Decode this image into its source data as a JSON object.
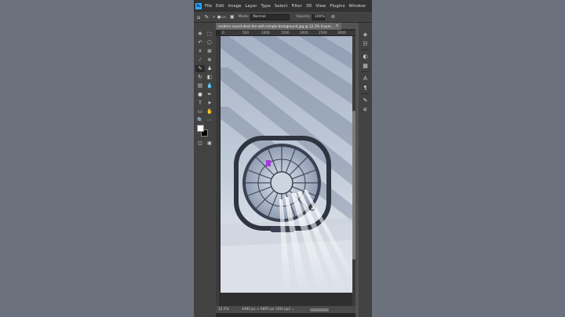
{
  "app": {
    "logo_text": "Ps"
  },
  "menu": [
    "File",
    "Edit",
    "Image",
    "Layer",
    "Type",
    "Select",
    "Filter",
    "3D",
    "View",
    "Plugins",
    "Window"
  ],
  "options_bar": {
    "icons": [
      "home-icon",
      "brush-icon",
      "brush-preset-icon"
    ],
    "brush_size": "125",
    "mode_label": "Mode:",
    "mode_value": "Normal",
    "opacity_label": "Opacity:",
    "opacity_value": "100%"
  },
  "document": {
    "tab_title": "modern-round-desk-fan-with-simple-background.jpg @ 12.2% (Layer...",
    "close_glyph": "×",
    "ruler_numbers": [
      "0",
      "500",
      "1000",
      "1500",
      "2000",
      "2500",
      "3000"
    ]
  },
  "tools": [
    {
      "name": "move-tool-icon",
      "glyph": "✥"
    },
    {
      "name": "marquee-tool-icon",
      "glyph": "⬚"
    },
    {
      "name": "lasso-tool-icon",
      "glyph": "↶"
    },
    {
      "name": "object-select-tool-icon",
      "glyph": "⬡"
    },
    {
      "name": "crop-tool-icon",
      "glyph": "⌗"
    },
    {
      "name": "frame-tool-icon",
      "glyph": "⊠"
    },
    {
      "name": "eyedropper-tool-icon",
      "glyph": "⁄"
    },
    {
      "name": "healing-brush-tool-icon",
      "glyph": "⊕"
    },
    {
      "name": "brush-tool-icon",
      "glyph": "✎"
    },
    {
      "name": "clone-stamp-tool-icon",
      "glyph": "♟"
    },
    {
      "name": "history-brush-tool-icon",
      "glyph": "↻"
    },
    {
      "name": "eraser-tool-icon",
      "glyph": "◧"
    },
    {
      "name": "gradient-tool-icon",
      "glyph": "▤"
    },
    {
      "name": "blur-tool-icon",
      "glyph": "💧"
    },
    {
      "name": "dodge-tool-icon",
      "glyph": "●"
    },
    {
      "name": "pen-tool-icon",
      "glyph": "✒"
    },
    {
      "name": "type-tool-icon",
      "glyph": "T"
    },
    {
      "name": "path-select-tool-icon",
      "glyph": "➤"
    },
    {
      "name": "rectangle-tool-icon",
      "glyph": "▭"
    },
    {
      "name": "hand-tool-icon",
      "glyph": "✋"
    },
    {
      "name": "zoom-tool-icon",
      "glyph": "🔍"
    },
    {
      "name": "more-tools-icon",
      "glyph": "⋯"
    }
  ],
  "colors": {
    "foreground": "#ffffff",
    "background": "#000000",
    "accent": "#31a8ff"
  },
  "status": {
    "zoom": "12.2%",
    "info": "4480 px × 6895 px (300 ppi)",
    "chevron": "›"
  },
  "right_panel_icons": [
    {
      "name": "layers-panel-icon",
      "glyph": "◈"
    },
    {
      "name": "adjustments-panel-icon",
      "glyph": "☷"
    },
    {
      "name": "color-panel-icon",
      "glyph": "◐"
    },
    {
      "name": "swatches-panel-icon",
      "glyph": "▦"
    },
    {
      "name": "character-panel-icon",
      "glyph": "A"
    },
    {
      "name": "paragraph-panel-icon",
      "glyph": "¶"
    },
    {
      "name": "brushes-panel-icon",
      "glyph": "✎"
    },
    {
      "name": "properties-panel-icon",
      "glyph": "⚟"
    }
  ]
}
